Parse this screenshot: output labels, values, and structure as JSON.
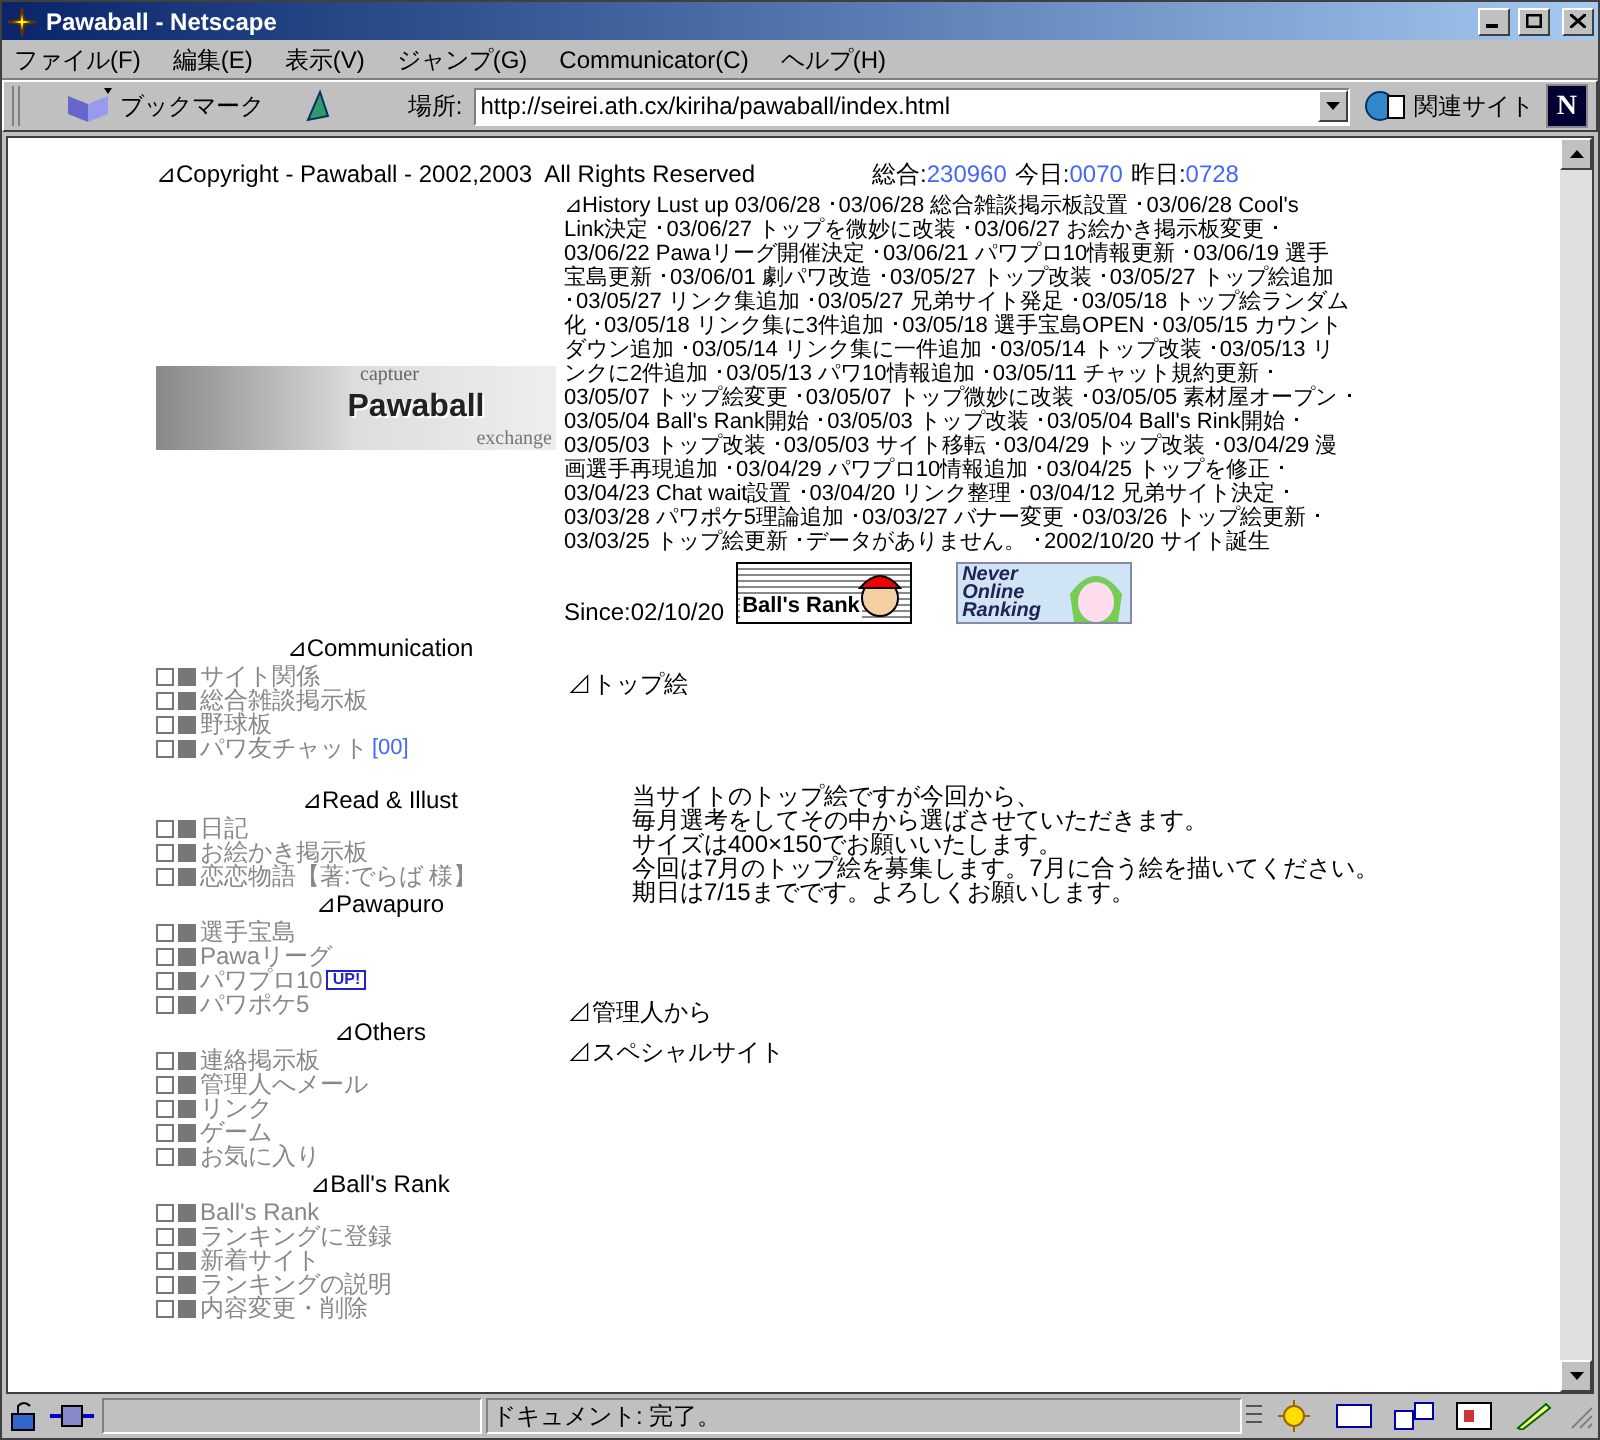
{
  "window": {
    "title": "Pawaball - Netscape"
  },
  "menu_bar": [
    "ファイル(F)",
    "編集(E)",
    "表示(V)",
    "ジャンプ(G)",
    "Communicator(C)",
    "ヘルプ(H)"
  ],
  "toolbar": {
    "bookmarks": "ブックマーク",
    "location_label": "場所:",
    "url": "http://seirei.ath.cx/kiriha/pawaball/index.html",
    "related": "関連サイト",
    "logo_letter": "N"
  },
  "page": {
    "copyright": "⊿Copyright - Pawaball - 2002,2003  All Rights Reserved",
    "counters": [
      {
        "label": "総合:",
        "value": "230960"
      },
      {
        "label": "今日:",
        "value": "0070"
      },
      {
        "label": "昨日:",
        "value": "0728"
      }
    ],
    "logo": {
      "top": "captuer",
      "name": "Pawaball",
      "bottom": "exchange"
    },
    "history": [
      "⊿History Lust up 03/06/28 ･03/06/28 総合雑談掲示板設置 ･03/06/28 Cool's",
      "Link決定 ･03/06/27 トップを微妙に改装 ･03/06/27 お絵かき掲示板変更 ･",
      "03/06/22 Pawaリーグ開催決定 ･03/06/21 パワプロ10情報更新 ･03/06/19 選手",
      "宝島更新 ･03/06/01 劇パワ改造 ･03/05/27 トップ改装 ･03/05/27 トップ絵追加",
      "･03/05/27 リンク集追加 ･03/05/27 兄弟サイト発足 ･03/05/18 トップ絵ランダム",
      "化 ･03/05/18 リンク集に3件追加 ･03/05/18 選手宝島OPEN ･03/05/15 カウント",
      "ダウン追加 ･03/05/14 リンク集に一件追加 ･03/05/14 トップ改装 ･03/05/13 リ",
      "ンクに2件追加 ･03/05/13 パワ10情報追加 ･03/05/11 チャット規約更新 ･",
      "03/05/07 トップ絵変更 ･03/05/07 トップ微妙に改装 ･03/05/05 素材屋オープン ･",
      "03/05/04 Ball's Rank開始 ･03/05/03 トップ改装 ･03/05/04 Ball's Rink開始 ･",
      "03/05/03 トップ改装 ･03/05/03 サイト移転 ･03/04/29 トップ改装 ･03/04/29 漫",
      "画選手再現追加 ･03/04/29 パワプロ10情報追加 ･03/04/25 トップを修正 ･",
      "03/04/23 Chat wait設置 ･03/04/20 リンク整理 ･03/04/12 兄弟サイト決定 ･",
      "03/03/28 パワポケ5理論追加 ･03/03/27 バナー変更 ･03/03/26 トップ絵更新 ･",
      "03/03/25 トップ絵更新 ･データがありません。 ･2002/10/20 サイト誕生"
    ],
    "since": "Since:02/10/20",
    "banners": [
      {
        "kind": "balls",
        "text": "Ball's Rank"
      },
      {
        "kind": "never",
        "text": "Never Online Ranking"
      }
    ],
    "nav": [
      {
        "title": "⊿Communication",
        "items": [
          {
            "label": "サイト関係"
          },
          {
            "label": "総合雑談掲示板"
          },
          {
            "label": "野球板"
          },
          {
            "label": "パワ友チャット",
            "badge": {
              "text": "[00]",
              "kind": "count"
            }
          }
        ]
      },
      {
        "title": "⊿Read & Illust",
        "items": [
          {
            "label": "日記"
          },
          {
            "label": "お絵かき掲示板"
          },
          {
            "label": "恋恋物語【著:でらば 様】"
          }
        ]
      },
      {
        "title": "⊿Pawapuro",
        "items": [
          {
            "label": "選手宝島"
          },
          {
            "label": "Pawaリーグ"
          },
          {
            "label": "パワプロ10",
            "badge": {
              "text": "UP!",
              "kind": "up"
            }
          },
          {
            "label": "パワポケ5"
          }
        ]
      },
      {
        "title": "⊿Others",
        "items": [
          {
            "label": "連絡掲示板"
          },
          {
            "label": "管理人へメール"
          },
          {
            "label": "リンク"
          },
          {
            "label": "ゲーム"
          },
          {
            "label": "お気に入り"
          }
        ]
      },
      {
        "title": "⊿Ball's Rank",
        "items": [
          {
            "label": "Ball's Rank"
          },
          {
            "label": "ランキングに登録"
          },
          {
            "label": "新着サイト"
          },
          {
            "label": "ランキングの説明"
          },
          {
            "label": "内容変更・削除"
          }
        ]
      }
    ],
    "sections": [
      {
        "heading": "⊿トップ絵",
        "lines": [
          "当サイトのトップ絵ですが今回から、",
          "毎月選考をしてその中から選ばさせていただきます。",
          "サイズは400×150でお願いいたします。",
          "今回は7月のトップ絵を募集します。7月に合う絵を描いてください。",
          "期日は7/15までです。よろしくお願いします。"
        ]
      },
      {
        "heading": "⊿管理人から"
      },
      {
        "heading": "⊿スペシャルサイト"
      }
    ]
  },
  "status_bar": {
    "text": "ドキュメント: 完了。"
  }
}
